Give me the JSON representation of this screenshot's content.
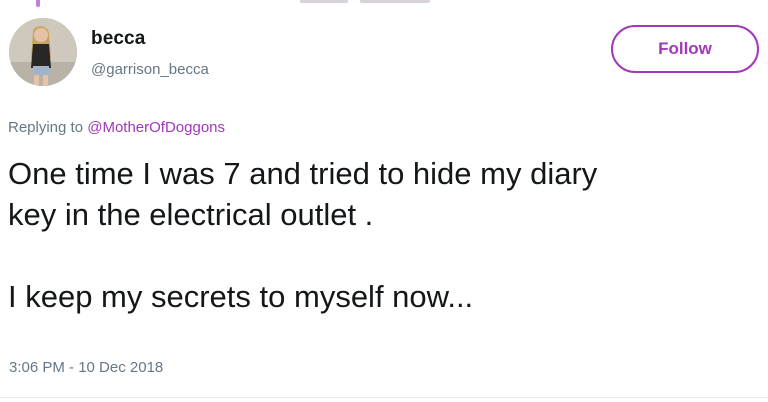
{
  "tweet": {
    "author": {
      "display_name": "becca",
      "handle": "@garrison_becca",
      "avatar_icon": "profile-photo"
    },
    "follow_label": "Follow",
    "replying": {
      "prefix": "Replying to",
      "mention": "@MotherOfDoggons"
    },
    "text": {
      "line1": "One time I was 7 and tried to hide my diary",
      "line2": "key in the electrical outlet .",
      "line3": "I keep my secrets to myself now..."
    },
    "timestamp": "3:06 PM - 10 Dec 2018"
  },
  "colors": {
    "accent": "#a238ba",
    "thread_line": "#c57ed6",
    "secondary_text": "#657786",
    "primary_text": "#14171a"
  }
}
